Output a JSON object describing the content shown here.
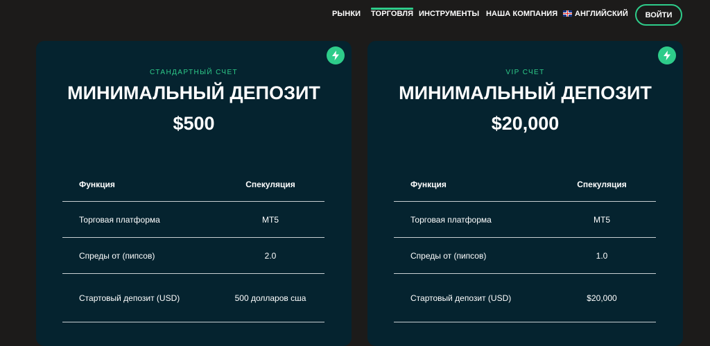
{
  "nav": {
    "items": [
      "РЫНКИ",
      "ТОРГОВЛЯ",
      "ИНСТРУМЕНТЫ",
      "НАША КОМПАНИЯ"
    ],
    "language": "АНГЛИЙСКИЙ",
    "login": "ВОЙТИ",
    "active": "ТОРГОВЛЯ",
    "accent_color": "#2ecc8a"
  },
  "cards": [
    {
      "subtitle": "СТАНДАРТНЫЙ СЧЕТ",
      "title": "МИНИМАЛЬНЫЙ ДЕПОЗИТ",
      "amount": "$500",
      "icon": "lightning-bolt-icon",
      "table": {
        "headers": [
          "Функция",
          "Спекуляция"
        ],
        "rows": [
          [
            "Торговая платформа",
            "MT5"
          ],
          [
            "Спреды от (пипсов)",
            "2.0"
          ],
          [
            "Стартовый депозит (USD)",
            "500 долларов сша"
          ]
        ]
      }
    },
    {
      "subtitle": "VIP СЧЕТ",
      "title": "МИНИМАЛЬНЫЙ ДЕПОЗИТ",
      "amount": "$20,000",
      "icon": "lightning-bolt-icon",
      "table": {
        "headers": [
          "Функция",
          "Спекуляция"
        ],
        "rows": [
          [
            "Торговая платформа",
            "MT5"
          ],
          [
            "Спреды от (пипсов)",
            "1.0"
          ],
          [
            "Стартовый депозит (USD)",
            "$20,000"
          ]
        ]
      }
    }
  ],
  "colors": {
    "background": "#1c1b1a",
    "card": "#05232f",
    "accent": "#2ecc8a"
  }
}
